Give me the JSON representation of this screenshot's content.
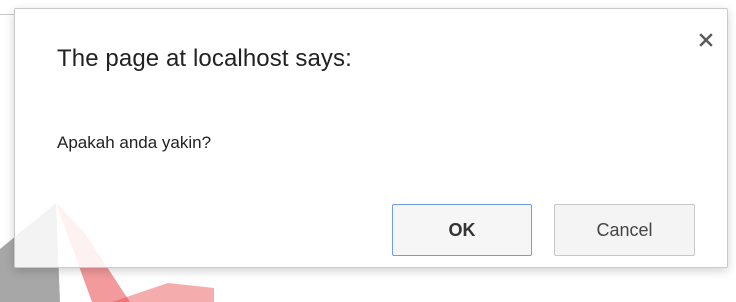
{
  "dialog": {
    "title": "The page at localhost says:",
    "message": "Apakah anda yakin?",
    "close_icon": "close-icon",
    "ok_label": "OK",
    "cancel_label": "Cancel"
  },
  "colors": {
    "ok_border": "#6d9ee8",
    "watermark_red": "#e8474a",
    "watermark_gray": "#8a8a8a"
  }
}
